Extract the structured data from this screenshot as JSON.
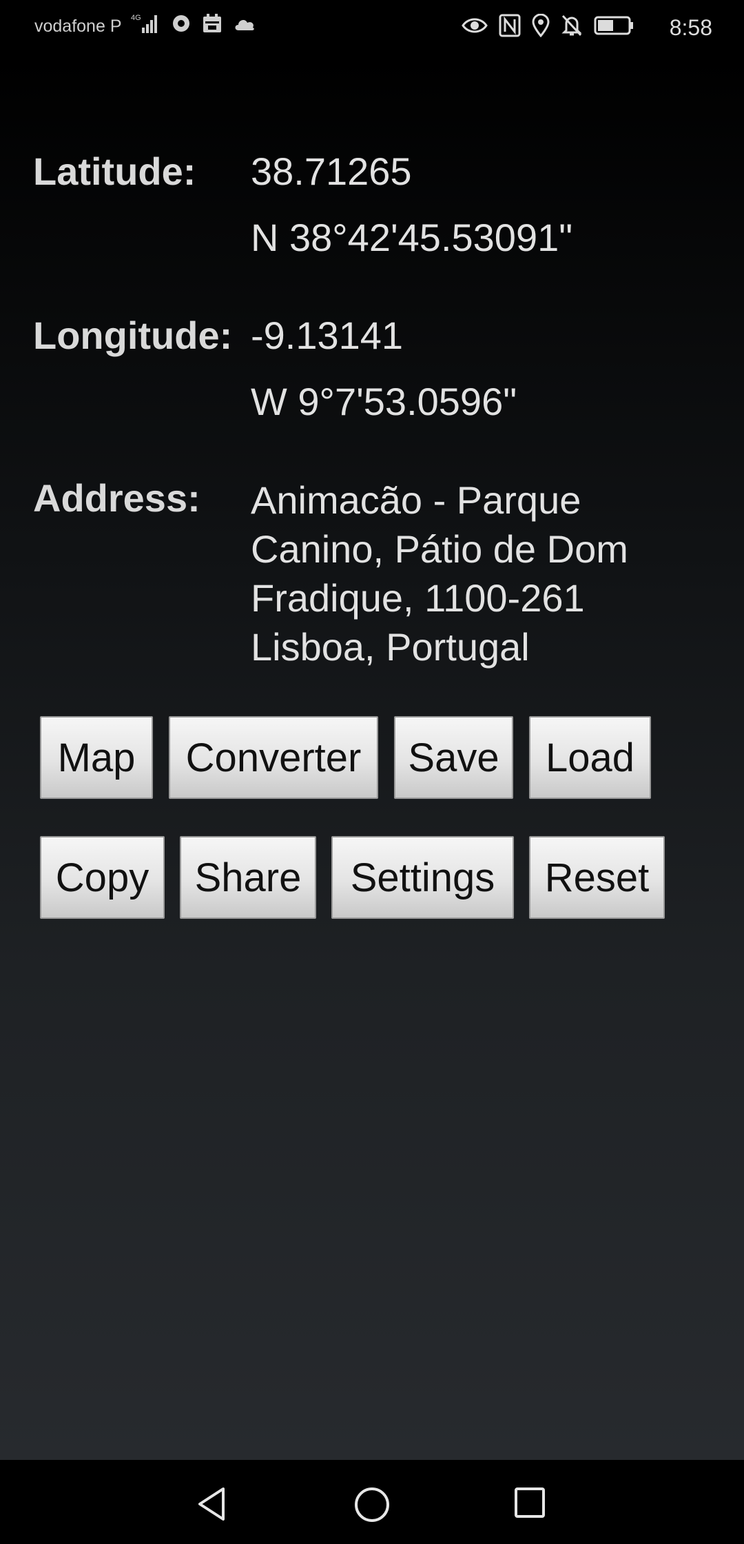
{
  "status_bar": {
    "carrier": "vodafone P",
    "network": "4G",
    "time": "8:58",
    "icons_left": [
      "signal-icon",
      "record-icon",
      "calendar-icon",
      "cloud-icon"
    ],
    "icons_right": [
      "eye-icon",
      "nfc-icon",
      "location-icon",
      "bell-off-icon",
      "battery-icon"
    ]
  },
  "coords": {
    "latitude_label": "Latitude:",
    "latitude_decimal": "38.71265",
    "latitude_dms": "N 38°42'45.53091\"",
    "longitude_label": "Longitude:",
    "longitude_decimal": "-9.13141",
    "longitude_dms": "W 9°7'53.0596\"",
    "address_label": "Address:",
    "address_lines": [
      "Animacão - Parque",
      "Canino, Pátio de Dom",
      "Fradique, 1100-261",
      "Lisboa, Portugal"
    ]
  },
  "buttons": {
    "map": "Map",
    "converter": "Converter",
    "save": "Save",
    "load": "Load",
    "copy": "Copy",
    "share": "Share",
    "settings": "Settings",
    "reset": "Reset"
  },
  "nav_bar": {
    "back": "back-icon",
    "home": "home-icon",
    "recents": "recents-icon"
  }
}
